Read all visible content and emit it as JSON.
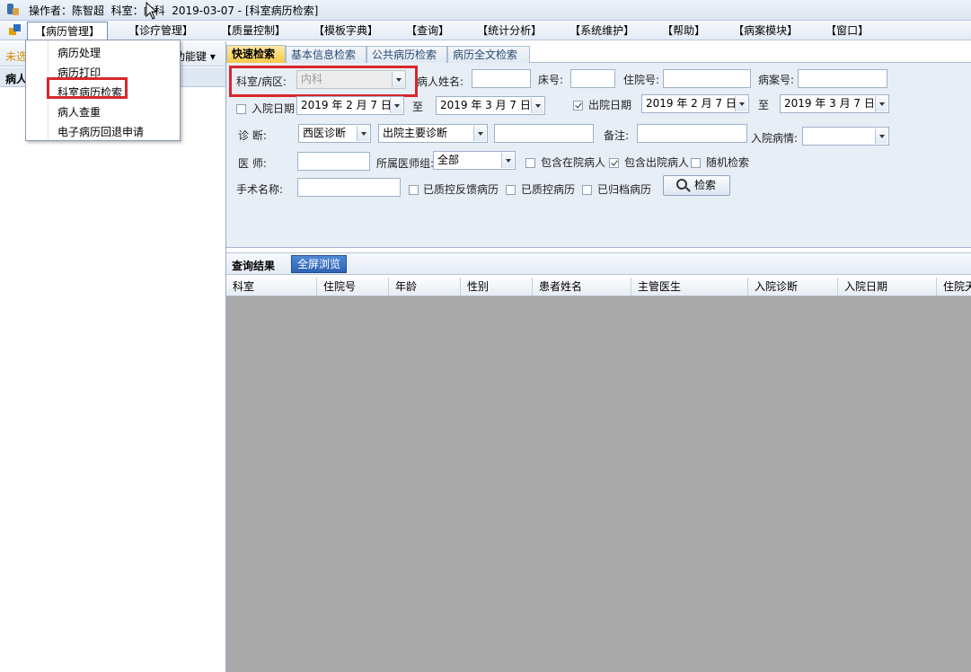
{
  "titlebar": {
    "text": "操作者：陈智超  科室：内科  2019-03-07 - [科室病历检索]"
  },
  "menubar": {
    "items": [
      "【病历管理】",
      "【诊疗管理】",
      "【质量控制】",
      "【模板字典】",
      "【查询】",
      "【统计分析】",
      "【系统维护】",
      "【帮助】",
      "【病案模块】",
      "【窗口】"
    ]
  },
  "dropdown": {
    "items": [
      "病历处理",
      "病历打印",
      "科室病历检索",
      "病人查重",
      "电子病历回退申请"
    ],
    "highlighted_index": 2
  },
  "leftbar": {
    "toolstrip_left": "未选",
    "toolstrip_right": "功能键",
    "header": "病人"
  },
  "tabs": [
    "快速检索",
    "基本信息检索",
    "公共病历检索",
    "病历全文检索"
  ],
  "form": {
    "dept_label": "科室/病区:",
    "dept_value": "内科",
    "patient_name_label": "病人姓名:",
    "bed_label": "床号:",
    "inpatient_no_label": "住院号:",
    "case_no_label": "病案号:",
    "admit_date_label": "入院日期",
    "admit_date_from": "2019 年 2 月 7 日",
    "to_label": "至",
    "admit_date_to": "2019 年 3 月 7 日",
    "discharge_date_label": "出院日期",
    "discharge_date_from": "2019 年 2 月 7 日",
    "discharge_date_to": "2019 年 3 月 7 日",
    "diagnosis_label": "诊      断:",
    "diagnosis_type": "西医诊断",
    "diagnosis_kind": "出院主要诊断",
    "remark_label": "备注:",
    "admit_condition_label": "入院病情:",
    "doctor_label": "医      师:",
    "doctor_group_label": "所属医师组:",
    "doctor_group_value": "全部",
    "include_inpatient_label": "包含在院病人",
    "include_discharged_label": "包含出院病人",
    "random_search_label": "随机检索",
    "surgery_label": "手术名称:",
    "qc_feedback_label": "已质控反馈病历",
    "qc_done_label": "已质控病历",
    "archived_label": "已归档病历",
    "search_button": "检索",
    "admit_date_checked": false,
    "discharge_date_checked": true,
    "include_inpatient_checked": false,
    "include_discharged_checked": true,
    "random_search_checked": false
  },
  "results": {
    "title": "查询结果",
    "fullscreen_button": "全屏浏览",
    "columns": [
      "科室",
      "住院号",
      "年龄",
      "性别",
      "患者姓名",
      "主管医生",
      "入院诊断",
      "入院日期",
      "住院天"
    ]
  }
}
